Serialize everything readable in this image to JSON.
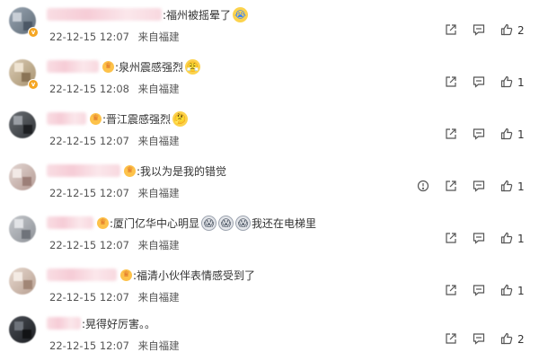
{
  "comments": [
    {
      "text": ":福州被摇晕了",
      "emoji": "crying-face-icon",
      "date": "22-12-15 12:07",
      "source": "来自福建",
      "likes": "2",
      "has_crown": false,
      "has_vbadge": true,
      "has_report": false
    },
    {
      "text": ":泉州震感强烈",
      "emoji": "angry-face-icon",
      "date": "22-12-15 12:08",
      "source": "来自福建",
      "likes": "1",
      "has_crown": true,
      "has_vbadge": true,
      "has_report": false
    },
    {
      "text": ":晋江震感强烈",
      "emoji": "thinking-face-icon",
      "date": "22-12-15 12:07",
      "source": "来自福建",
      "likes": "1",
      "has_crown": true,
      "has_vbadge": false,
      "has_report": false
    },
    {
      "text": ":我以为是我的错觉",
      "emoji": "",
      "date": "22-12-15 12:07",
      "source": "来自福建",
      "likes": "1",
      "has_crown": true,
      "has_vbadge": false,
      "has_report": true
    },
    {
      "text": ":厦门亿华中心明显",
      "text_suffix": "我还在电梯里",
      "emoji": "screaming-face-icon",
      "date": "22-12-15 12:07",
      "source": "来自福建",
      "likes": "1",
      "has_crown": true,
      "has_vbadge": false,
      "has_report": false
    },
    {
      "text": ":福清小伙伴表情感受到了",
      "emoji": "",
      "date": "22-12-15 12:07",
      "source": "来自福建",
      "likes": "1",
      "has_crown": true,
      "has_vbadge": false,
      "has_report": false
    },
    {
      "text": ":晃得好厉害。。",
      "emoji": "",
      "date": "22-12-15 12:07",
      "source": "来自福建",
      "likes": "2",
      "has_crown": false,
      "has_vbadge": false,
      "has_report": false
    }
  ],
  "colors": {
    "text": "#333333",
    "meta": "#555555",
    "icon": "#555555",
    "name_blur": "#f6ccd6",
    "crown": "#fdc24a"
  },
  "icons": {
    "share": "share-icon",
    "comment": "comment-icon",
    "like": "thumbs-up-icon",
    "report": "report-icon"
  }
}
